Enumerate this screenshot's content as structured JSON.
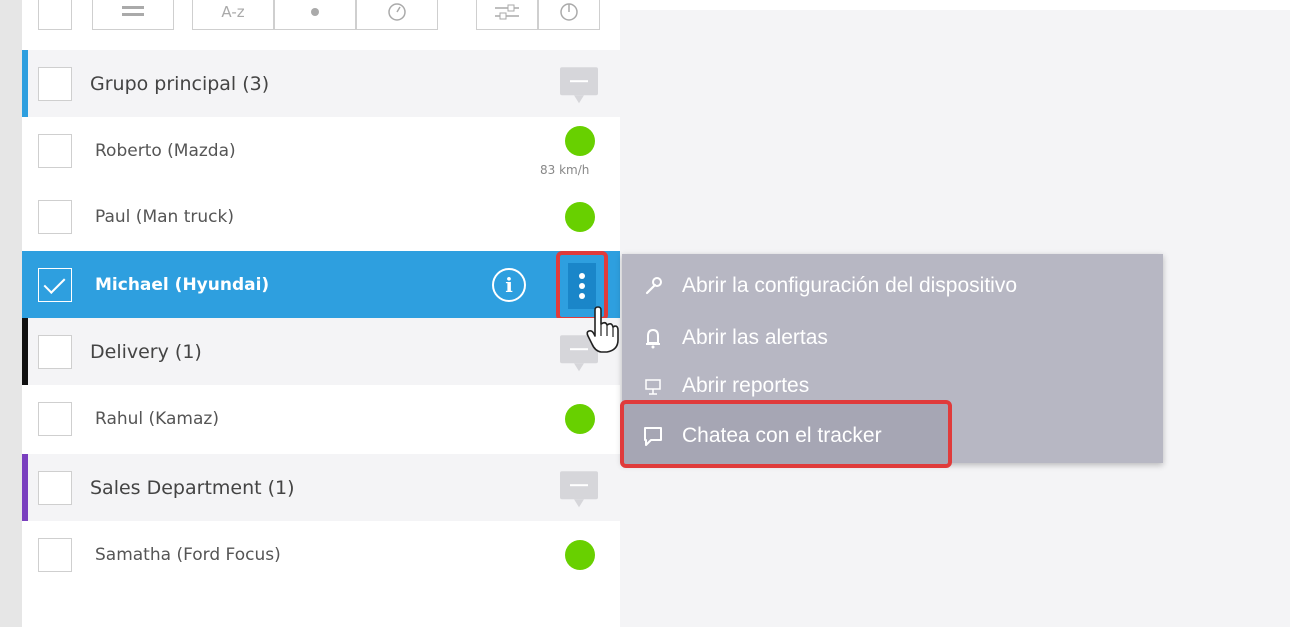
{
  "toolbar": {
    "sort_alpha_label": "A-z"
  },
  "groups": [
    {
      "label": "Grupo principal (3)",
      "accent": "#2e9fdf"
    },
    {
      "label": "Delivery (1)",
      "accent": "#111111"
    },
    {
      "label": "Sales Department (1)",
      "accent": "#7a3fbf"
    }
  ],
  "devices": [
    {
      "label": "Roberto (Mazda)",
      "speed": "83 km/h",
      "status_color": "#68d000"
    },
    {
      "label": "Paul (Man truck)",
      "status_color": "#68d000"
    },
    {
      "label": "Michael (Hyundai)",
      "selected": true
    },
    {
      "label": "Rahul (Kamaz)",
      "status_color": "#68d000"
    },
    {
      "label": "Samatha (Ford Focus)",
      "status_color": "#68d000"
    }
  ],
  "context_menu": {
    "items": [
      {
        "icon": "wrench-icon",
        "label": "Abrir la configuración del dispositivo"
      },
      {
        "icon": "bell-icon",
        "label": "Abrir las alertas"
      },
      {
        "icon": "presentation-icon",
        "label": "Abrir reportes"
      },
      {
        "icon": "chat-bubble-icon",
        "label": "Chatea con el tracker"
      }
    ]
  },
  "colors": {
    "selected_row": "#2e9fdf",
    "status_online": "#68d000",
    "highlight": "#e03b3b",
    "menu_bg": "#b7b7c3"
  }
}
